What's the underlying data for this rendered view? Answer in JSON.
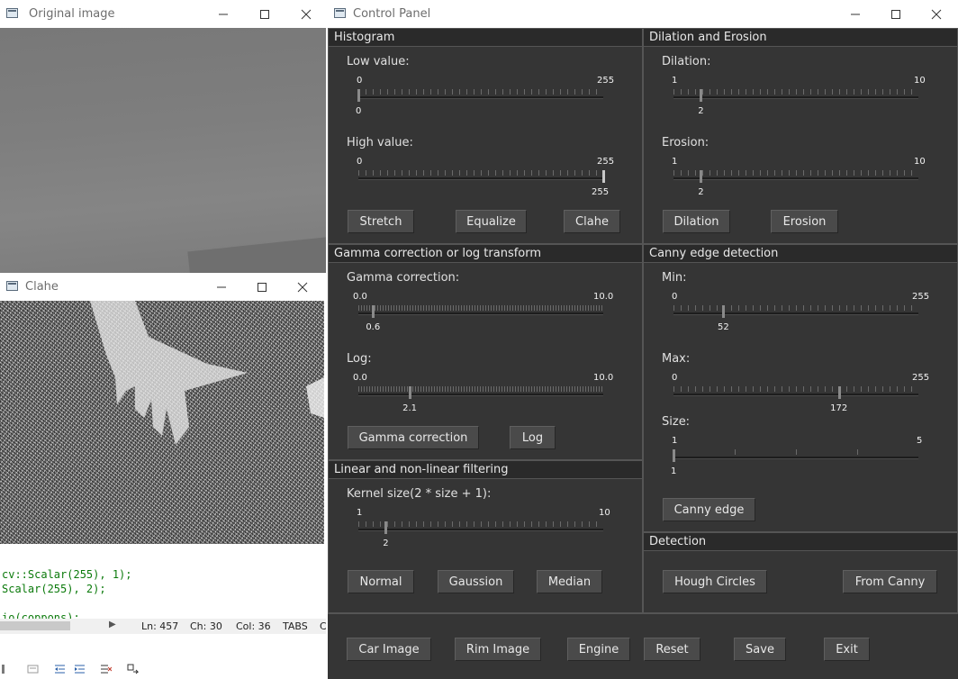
{
  "windows": {
    "original": {
      "title": "Original image"
    },
    "clahe": {
      "title": "Clahe"
    },
    "control_panel": {
      "title": "Control Panel"
    }
  },
  "editor": {
    "code_lines": [
      "cv::Scalar(255), 1);",
      "Scalar(255), 2);",
      "io(coppons);"
    ],
    "status": {
      "ln": "Ln: 457",
      "ch": "Ch: 30",
      "col": "Col: 36",
      "tabs": "TABS",
      "extra": "C"
    }
  },
  "histogram": {
    "title": "Histogram",
    "low": {
      "label": "Low value:",
      "min": "0",
      "max": "255",
      "value": "0",
      "fraction": 0.0
    },
    "high": {
      "label": "High value:",
      "min": "0",
      "max": "255",
      "value": "255",
      "fraction": 1.0
    },
    "buttons": {
      "stretch": "Stretch",
      "equalize": "Equalize",
      "clahe": "Clahe"
    }
  },
  "dilation_erosion": {
    "title": "Dilation and Erosion",
    "dilation": {
      "label": "Dilation:",
      "min": "1",
      "max": "10",
      "value": "2",
      "fraction": 0.111
    },
    "erosion": {
      "label": "Erosion:",
      "min": "1",
      "max": "10",
      "value": "2",
      "fraction": 0.111
    },
    "buttons": {
      "dilation": "Dilation",
      "erosion": "Erosion"
    }
  },
  "gamma_log": {
    "title": "Gamma correction or log transform",
    "gamma": {
      "label": "Gamma correction:",
      "min": "0.0",
      "max": "10.0",
      "value": "0.6",
      "fraction": 0.06
    },
    "log": {
      "label": "Log:",
      "min": "0.0",
      "max": "10.0",
      "value": "2.1",
      "fraction": 0.21
    },
    "buttons": {
      "gamma": "Gamma correction",
      "log": "Log"
    }
  },
  "canny": {
    "title": "Canny edge detection",
    "min": {
      "label": "Min:",
      "min": "0",
      "max": "255",
      "value": "52",
      "fraction": 0.204
    },
    "max": {
      "label": "Max:",
      "min": "0",
      "max": "255",
      "value": "172",
      "fraction": 0.675
    },
    "size": {
      "label": "Size:",
      "min": "1",
      "max": "5",
      "value": "1",
      "fraction": 0.0
    },
    "buttons": {
      "canny": "Canny edge"
    }
  },
  "filtering": {
    "title": "Linear and non-linear filtering",
    "kernel": {
      "label": "Kernel size(2 * size + 1):",
      "min": "1",
      "max": "10",
      "value": "2",
      "fraction": 0.111
    },
    "buttons": {
      "normal": "Normal",
      "gaussian": "Gaussion",
      "median": "Median"
    }
  },
  "detection": {
    "title": "Detection",
    "buttons": {
      "hough": "Hough Circles",
      "from_canny": "From Canny"
    }
  },
  "bottom": {
    "buttons": {
      "car": "Car Image",
      "rim": "Rim Image",
      "engine": "Engine",
      "reset": "Reset",
      "save": "Save",
      "exit": "Exit"
    }
  }
}
